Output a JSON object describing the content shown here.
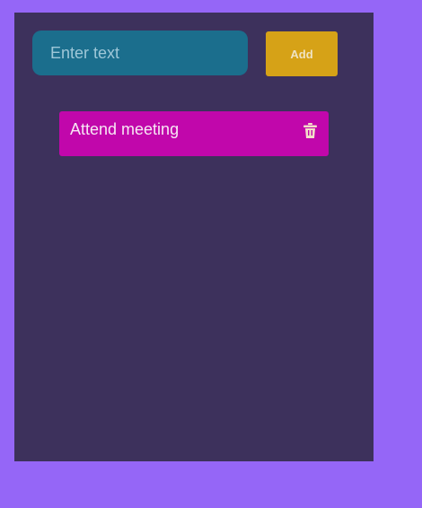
{
  "input": {
    "placeholder": "Enter text",
    "value": ""
  },
  "add_button": {
    "label": "Add"
  },
  "todos": [
    {
      "label": "Attend meeting",
      "delete_icon": "trash-icon"
    }
  ],
  "colors": {
    "page_background": "#9566f7",
    "panel_background": "#3d315c",
    "input_background": "#1b6e8d",
    "add_button_background": "#d6a217",
    "todo_item_background": "#c107ab",
    "todo_text": "#f7e8f4",
    "delete_icon": "#f3dfc9"
  }
}
